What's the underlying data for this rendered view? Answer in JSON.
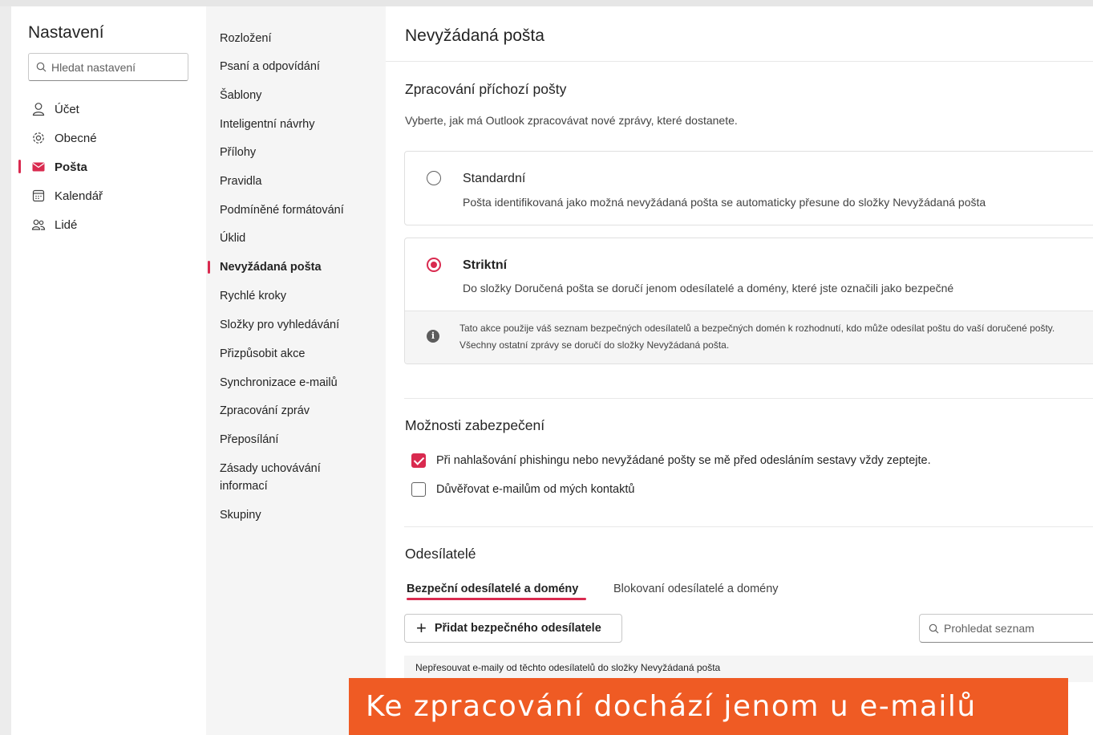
{
  "settings_nav": {
    "title": "Nastavení",
    "search_placeholder": "Hledat nastavení",
    "items": [
      {
        "label": "Účet",
        "icon": "person-icon"
      },
      {
        "label": "Obecné",
        "icon": "gear-icon"
      },
      {
        "label": "Pošta",
        "icon": "mail-icon",
        "active": true
      },
      {
        "label": "Kalendář",
        "icon": "calendar-icon"
      },
      {
        "label": "Lidé",
        "icon": "people-icon"
      }
    ]
  },
  "mail_subnav": {
    "items": [
      "Rozložení",
      "Psaní a odpovídání",
      "Šablony",
      "Inteligentní návrhy",
      "Přílohy",
      "Pravidla",
      "Podmíněné formátování",
      "Úklid",
      "Nevyžádaná pošta",
      "Rychlé kroky",
      "Složky pro vyhledávání",
      "Přizpůsobit akce",
      "Synchronizace e-mailů",
      "Zpracování zpráv",
      "Přeposílání",
      "Zásady uchovávání informací",
      "Skupiny"
    ],
    "active_index": 8
  },
  "main": {
    "title": "Nevyžádaná pošta",
    "incoming": {
      "heading": "Zpracování příchozí pošty",
      "description": "Vyberte, jak má Outlook zpracovávat nové zprávy, které dostanete.",
      "options": [
        {
          "title": "Standardní",
          "description": "Pošta identifikovaná jako možná nevyžádaná pošta se automaticky přesune do složky Nevyžádaná pošta",
          "selected": false
        },
        {
          "title": "Striktní",
          "description": "Do složky Doručená pošta se doručí jenom odesílatelé a domény, které jste označili jako bezpečné",
          "selected": true,
          "info": "Tato akce použije váš seznam bezpečných odesílatelů a bezpečných domén k rozhodnutí, kdo může odesílat poštu do vaší doručené pošty. Všechny ostatní zprávy se doručí do složky Nevyžádaná pošta."
        }
      ]
    },
    "security": {
      "heading": "Možnosti zabezpečení",
      "options": [
        {
          "label": "Při nahlašování phishingu nebo nevyžádané pošty se mě před odesláním sestavy vždy zeptejte.",
          "checked": true
        },
        {
          "label": "Důvěřovat e-mailům od mých kontaktů",
          "checked": false
        }
      ]
    },
    "senders": {
      "heading": "Odesílatelé",
      "tabs": [
        "Bezpeční odesílatelé a domény",
        "Blokovaní odesílatelé a domény"
      ],
      "active_tab": 0,
      "add_button": "Přidat bezpečného odesílatele",
      "search_placeholder": "Prohledat seznam",
      "list_header": "Nepřesouvat e-maily od těchto odesílatelů do složky Nevyžádaná pošta"
    }
  },
  "caption": "Ke zpracování dochází jenom u e-mailů",
  "colors": {
    "accent": "#d92a4f",
    "caption_bg": "#ef5b24"
  }
}
